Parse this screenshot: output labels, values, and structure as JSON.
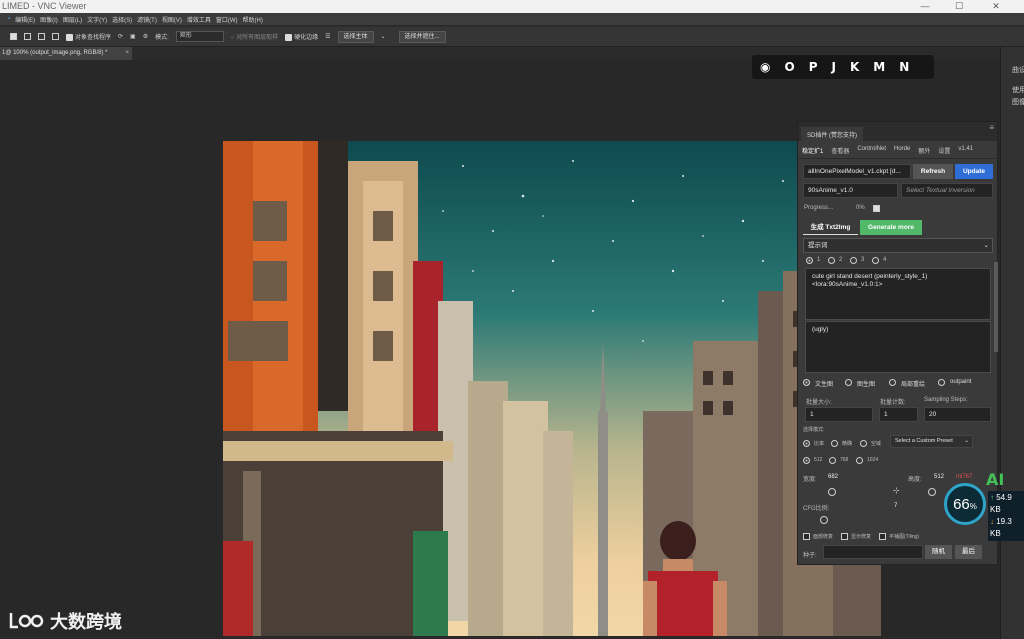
{
  "window": {
    "title": "LIMED - VNC Viewer"
  },
  "menubar": [
    "编辑(E)",
    "图像(I)",
    "图层(L)",
    "文字(Y)",
    "选择(S)",
    "滤镜(T)",
    "视图(V)",
    "增效工具",
    "窗口(W)",
    "帮助(H)"
  ],
  "options_bar": {
    "sample_all_layers": "对象查找程序",
    "mode_label": "模式:",
    "mode_value": "矩形",
    "all_layers": "对所有图层取样",
    "enhance_edge": "硬化边缘",
    "select_subject": "选择主体",
    "select_and_mask": "选择并遮住..."
  },
  "doc_tab": {
    "label": "1@ 100% (output_image.png, RGB/8) *",
    "close": "×"
  },
  "shortcut_bar": [
    "O",
    "P",
    "J",
    "K",
    "M",
    "N"
  ],
  "right_panel": {
    "title": "曲设",
    "line1": "使用",
    "line2": "图像"
  },
  "sd_plugin": {
    "title": "SD插件 (赞您支持)",
    "tabs": [
      "稳定扩1",
      "查看器",
      "ControlNet",
      "Horde",
      "额外",
      "设置",
      "v1.41"
    ],
    "model": "allInOnePixelModel_v1.ckpt [d...",
    "refresh": "Refresh",
    "update": "Update",
    "lora": "90sAnime_v1.0",
    "textual_inversion_placeholder": "Select Textual Inversion",
    "progress_label": "Progress...",
    "progress_value": "0%",
    "progress_fraction": 0,
    "generate_txt2img": "生成 Txt2Img",
    "generate_more": "Generate more",
    "prompt_header": "提示词",
    "prompt_tabs": [
      "1",
      "2",
      "3",
      "4"
    ],
    "prompt_positive_line1": "cute girl  stand  desert  (peinterly_style_1)",
    "prompt_positive_line2": "<lora:90sAnime_v1.0:1>",
    "prompt_negative": "(ugly)",
    "modes": [
      "文生图",
      "图生图",
      "局部重绘",
      "outpaint"
    ],
    "batch_size_label": "批量大小:",
    "batch_size": "1",
    "batch_count_label": "批量计数:",
    "batch_count": "1",
    "steps_label": "Sampling Steps:",
    "steps": "20",
    "select_mode_label": "选择模式:",
    "ratio_options": [
      "比率",
      "精确",
      "空域"
    ],
    "preset": "Select a Custom Preset",
    "size_options": [
      "512",
      "768",
      "1024"
    ],
    "width_label": "宽度:",
    "width_value": "682",
    "height_label": "高度:",
    "height_value": "512",
    "height_warn": "mi767",
    "cfg_label": "CFG比例:",
    "cfg_value": "7",
    "checks": [
      "面部修复",
      "显示修复",
      "平铺图(Tiling)"
    ],
    "seed_label": "种子:",
    "random_button": "随机",
    "last_button": "最后"
  },
  "watermark": {
    "text": "大数跨境"
  },
  "net_gauge": {
    "percent": "66",
    "unit": "%",
    "up": "54.9 KB",
    "down": "19.3 KB"
  },
  "badge": {
    "text": "AI"
  },
  "colors": {
    "refresh": "#555555",
    "update": "#2f6ed6",
    "generate_more": "#52b86a",
    "gauge": "#2fa4c9"
  }
}
